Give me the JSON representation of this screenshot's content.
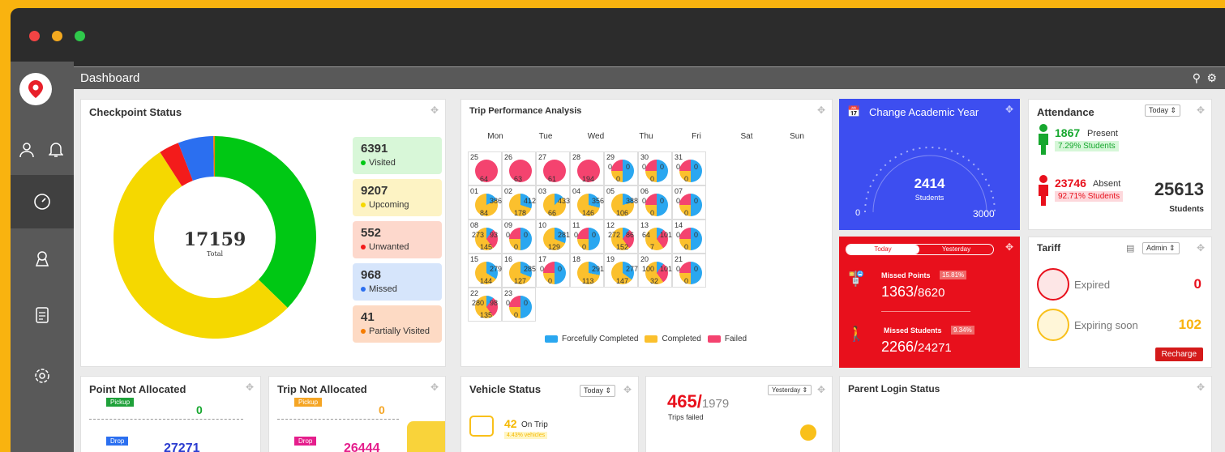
{
  "window": {
    "controls": [
      "close",
      "minimize",
      "maximize"
    ]
  },
  "sidebar": {
    "items": [
      "logo-pin-icon",
      "user-icon",
      "bell-icon",
      "gauge-icon",
      "route-icon",
      "document-icon",
      "settings-icon"
    ]
  },
  "header": {
    "title": "Dashboard"
  },
  "checkpoint": {
    "title": "Checkpoint Status",
    "total": "17159",
    "total_label": "Total",
    "stats": [
      {
        "value": "6391",
        "label": "Visited",
        "color": "#00c814",
        "bg": "#d8f7d8"
      },
      {
        "value": "9207",
        "label": "Upcoming",
        "color": "#f5d800",
        "bg": "#fdf3c4"
      },
      {
        "value": "552",
        "label": "Unwanted",
        "color": "#f31b1b",
        "bg": "#fdd8cc"
      },
      {
        "value": "968",
        "label": "Missed",
        "color": "#2b6ff0",
        "bg": "#d6e5fb"
      },
      {
        "value": "41",
        "label": "Partially Visited",
        "color": "#f57c00",
        "bg": "#fddac4"
      }
    ]
  },
  "trip": {
    "title": "Trip Performance Analysis",
    "days": [
      "Mon",
      "Tue",
      "Wed",
      "Thu",
      "Fri",
      "Sat",
      "Sun"
    ],
    "cells": [
      {
        "d": "25",
        "v": [
          "64"
        ]
      },
      {
        "d": "26",
        "v": [
          "63"
        ]
      },
      {
        "d": "27",
        "v": [
          "61"
        ]
      },
      {
        "d": "28",
        "v": [
          "194"
        ]
      },
      {
        "d": "29",
        "v": [
          "0",
          "0",
          "0"
        ]
      },
      {
        "d": "30",
        "v": [
          "0",
          "0",
          "0"
        ]
      },
      {
        "d": "31",
        "v": [
          "0",
          "0",
          "0"
        ]
      },
      {
        "d": "01",
        "v": [
          "84",
          "386"
        ]
      },
      {
        "d": "02",
        "v": [
          "178",
          "412"
        ]
      },
      {
        "d": "03",
        "v": [
          "66",
          "433"
        ]
      },
      {
        "d": "04",
        "v": [
          "146",
          "356"
        ]
      },
      {
        "d": "05",
        "v": [
          "106",
          "388"
        ]
      },
      {
        "d": "06",
        "v": [
          "0",
          "0",
          "0"
        ]
      },
      {
        "d": "07",
        "v": [
          "0",
          "0",
          "0"
        ]
      },
      {
        "d": "08",
        "v": [
          "145",
          "93",
          "273"
        ]
      },
      {
        "d": "09",
        "v": [
          "0",
          "0",
          "0"
        ]
      },
      {
        "d": "10",
        "v": [
          "129",
          "281"
        ]
      },
      {
        "d": "11",
        "v": [
          "0",
          "0",
          "0"
        ]
      },
      {
        "d": "12",
        "v": [
          "152",
          "86",
          "272"
        ]
      },
      {
        "d": "13",
        "v": [
          "7",
          "101",
          "64"
        ]
      },
      {
        "d": "14",
        "v": [
          "0",
          "0",
          "0"
        ]
      },
      {
        "d": "15",
        "v": [
          "144",
          "279"
        ]
      },
      {
        "d": "16",
        "v": [
          "127",
          "285"
        ]
      },
      {
        "d": "17",
        "v": [
          "0",
          "0",
          "0"
        ]
      },
      {
        "d": "18",
        "v": [
          "113",
          "291"
        ]
      },
      {
        "d": "19",
        "v": [
          "147",
          "277"
        ]
      },
      {
        "d": "20",
        "v": [
          "32",
          "101",
          "100"
        ]
      },
      {
        "d": "21",
        "v": [
          "0",
          "0",
          "0"
        ]
      },
      {
        "d": "22",
        "v": [
          "135",
          "98",
          "280"
        ]
      },
      {
        "d": "23",
        "v": [
          "0",
          "0",
          "0"
        ]
      }
    ],
    "legend": [
      "Forcefully Completed",
      "Completed",
      "Failed"
    ],
    "colors": {
      "forced": "#2aa7f0",
      "completed": "#fbc02d",
      "failed": "#f4436f"
    }
  },
  "academic": {
    "title": "Change Academic Year",
    "value": "2414",
    "unit": "Students",
    "min": "0",
    "max": "3000"
  },
  "missed": {
    "toggle": [
      "Today",
      "Yesterday"
    ],
    "points_label": "Missed Points",
    "points_pct": "15.81%",
    "points_val": "1363/",
    "points_total": "8620",
    "students_label": "Missed Students",
    "students_pct": "9.34%",
    "students_val": "2266/",
    "students_total": "24271"
  },
  "attendance": {
    "title": "Attendance",
    "filter": "Today",
    "present": "1867",
    "present_label": "Present",
    "present_pct": "7.29% Students",
    "absent": "23746",
    "absent_label": "Absent",
    "absent_pct": "92.71% Students",
    "total": "25613",
    "total_label": "Students"
  },
  "tariff": {
    "title": "Tariff",
    "filter": "Admin",
    "expired_label": "Expired",
    "expired": "0",
    "expiring_label": "Expiring soon",
    "expiring": "102",
    "button": "Recharge"
  },
  "point_na": {
    "title": "Point Not Allocated",
    "pickup": "Pickup",
    "pickup_val": "0",
    "drop": "Drop",
    "drop_val": "27271"
  },
  "trip_na": {
    "title": "Trip Not Allocated",
    "pickup": "Pickup",
    "pickup_val": "0",
    "drop": "Drop",
    "drop_val": "26444"
  },
  "vehicle": {
    "title": "Vehicle Status",
    "filter": "Today",
    "on_trip": "42",
    "on_trip_label": "On Trip",
    "pct": "4.43% vehicles"
  },
  "trips_failed": {
    "filter": "Yesterday",
    "value": "465/",
    "total": "1979",
    "label": "Trips failed"
  },
  "parent": {
    "title": "Parent Login Status"
  }
}
